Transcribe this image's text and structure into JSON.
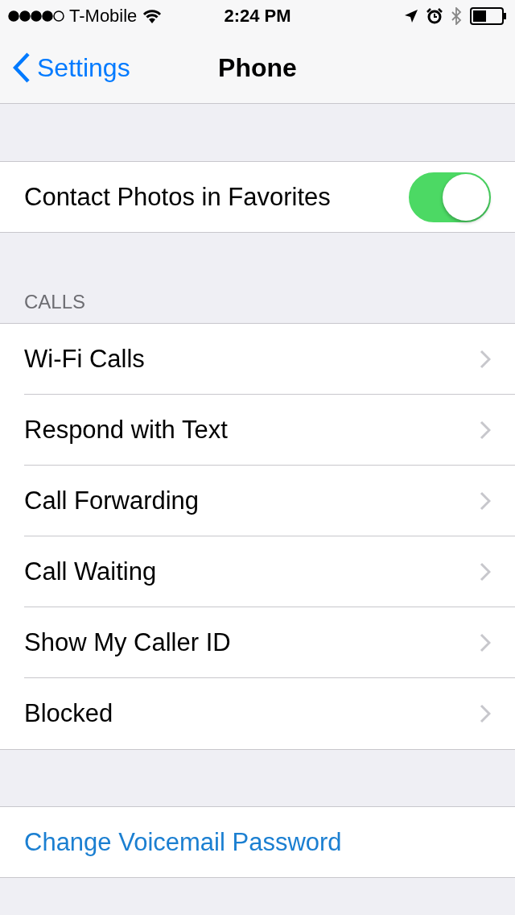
{
  "status_bar": {
    "carrier": "T-Mobile",
    "time": "2:24 PM"
  },
  "nav": {
    "back": "Settings",
    "title": "Phone"
  },
  "toggle_row": {
    "label": "Contact Photos in Favorites",
    "on": true
  },
  "calls_section": {
    "header": "CALLS",
    "items": [
      {
        "label": "Wi-Fi Calls"
      },
      {
        "label": "Respond with Text"
      },
      {
        "label": "Call Forwarding"
      },
      {
        "label": "Call Waiting"
      },
      {
        "label": "Show My Caller ID"
      },
      {
        "label": "Blocked"
      }
    ]
  },
  "voicemail": {
    "label": "Change Voicemail Password"
  }
}
